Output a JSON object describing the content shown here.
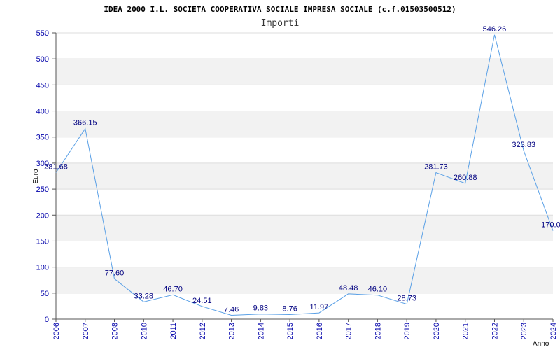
{
  "chart_data": {
    "type": "line",
    "title": "IDEA 2000 I.L. SOCIETA COOPERATIVA SOCIALE IMPRESA SOCIALE (c.f.01503500512)",
    "subtitle": "Importi",
    "xlabel": "Anno",
    "ylabel": "Euro",
    "ylim": [
      0,
      550
    ],
    "yticks": [
      0,
      50,
      100,
      150,
      200,
      250,
      300,
      350,
      400,
      450,
      500,
      550
    ],
    "categories": [
      "2006",
      "2007",
      "2008",
      "2010",
      "2011",
      "2012",
      "2013",
      "2014",
      "2015",
      "2016",
      "2017",
      "2018",
      "2019",
      "2020",
      "2021",
      "2022",
      "2023",
      "2024"
    ],
    "values": [
      281.68,
      366.15,
      77.6,
      33.28,
      46.7,
      24.51,
      7.46,
      9.83,
      8.76,
      11.97,
      48.48,
      46.1,
      28.73,
      281.73,
      260.88,
      546.26,
      323.83,
      170.04
    ],
    "value_labels": [
      "281.68",
      "366.15",
      "77.60",
      "33.28",
      "46.70",
      "24.51",
      "7.46",
      "9.83",
      "8.76",
      "11.97",
      "48.48",
      "46.10",
      "28.73",
      "281.73",
      "260.88",
      "546.26",
      "323.83",
      "170.04"
    ],
    "grid": true,
    "colors": {
      "line": "#5aa0e6",
      "band": "#f2f2f2",
      "tick": "#0000aa",
      "label": "#000080"
    }
  }
}
